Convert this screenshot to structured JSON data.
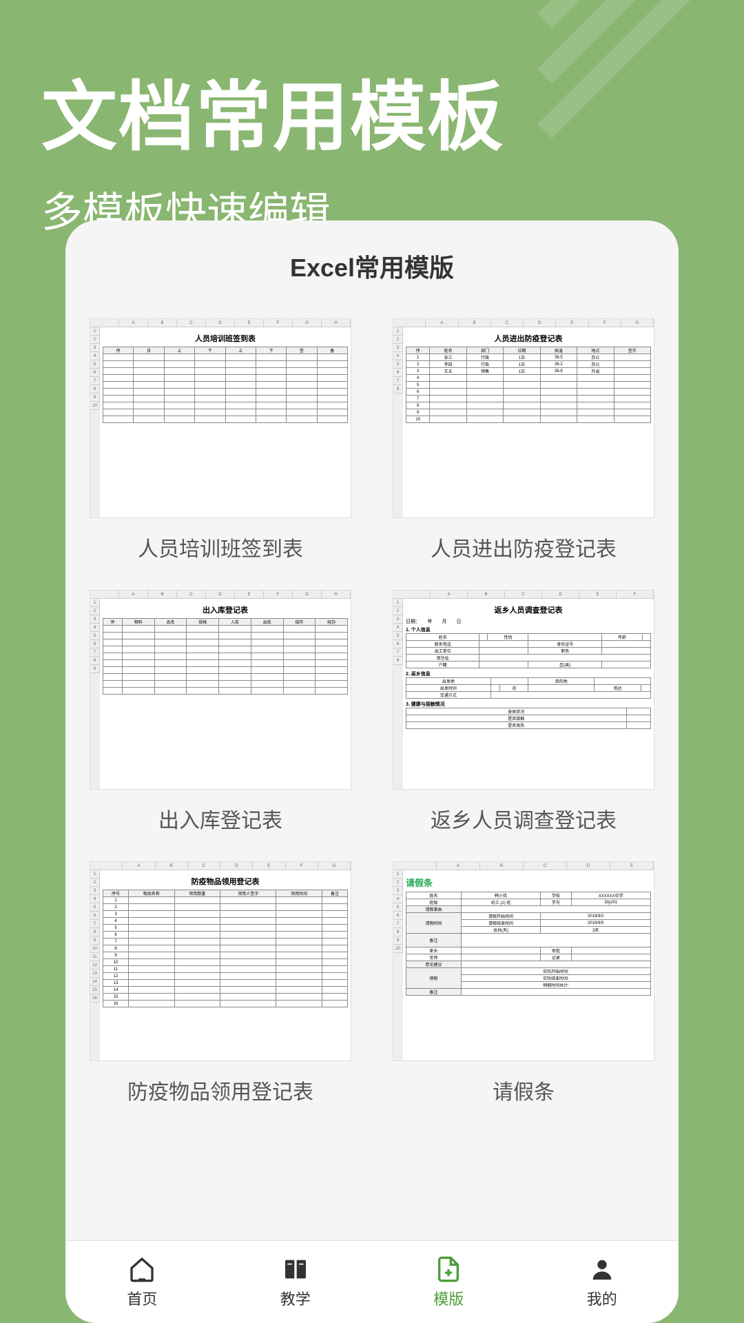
{
  "header": {
    "main_title": "文档常用模板",
    "sub_title": "多模板快速编辑"
  },
  "section_title": "Excel常用模版",
  "templates": [
    {
      "label": "人员培训班签到表",
      "doc_title": "人员培训班签到表"
    },
    {
      "label": "人员进出防疫登记表",
      "doc_title": "人员进出防疫登记表"
    },
    {
      "label": "出入库登记表",
      "doc_title": "出入库登记表"
    },
    {
      "label": "返乡人员调查登记表",
      "doc_title": "返乡人员调查登记表"
    },
    {
      "label": "防疫物品领用登记表",
      "doc_title": "防疫物品领用登记表"
    },
    {
      "label": "请假条",
      "doc_title": "请假条"
    }
  ],
  "nav": [
    {
      "label": "首页",
      "active": false
    },
    {
      "label": "教学",
      "active": false
    },
    {
      "label": "模版",
      "active": true
    },
    {
      "label": "我的",
      "active": false
    }
  ],
  "colors": {
    "background": "#89b670",
    "accent": "#4a9e3a"
  }
}
